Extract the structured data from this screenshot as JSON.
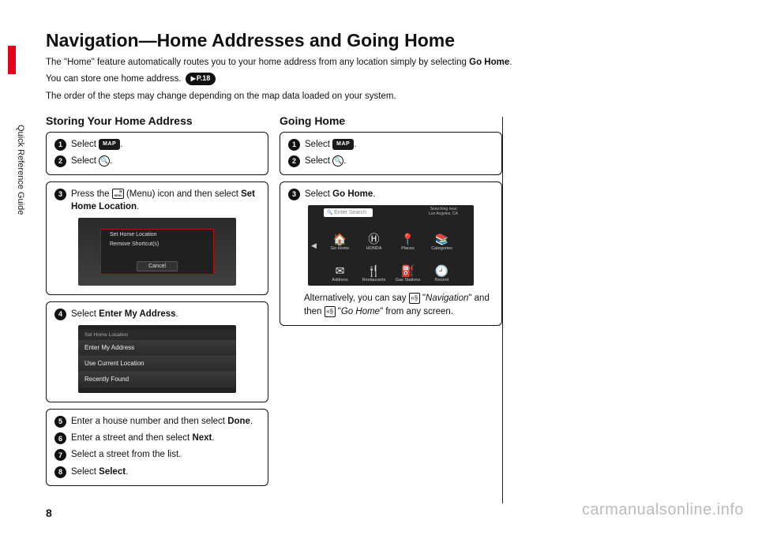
{
  "side_label": "Quick Reference Guide",
  "page_number": "8",
  "watermark": "carmanualsonline.info",
  "title": "Navigation—Home Addresses and Going Home",
  "intro1_pre": "The \"Home\" feature automatically routes you to your home address from any location simply by selecting ",
  "intro1_bold": "Go Home",
  "intro2_pre": "You can store one home address. ",
  "pref": "P.18",
  "intro3": "The order of the steps may change depending on the map data loaded on your system.",
  "colA_title": "Storing Your Home Address",
  "colB_title": "Going Home",
  "step_select": "Select ",
  "map_label": "MAP",
  "q_glyph": "🔍",
  "colA": {
    "s3_pre": "Press the ",
    "s3_mid": " (Menu) icon and then select ",
    "s3_bold": "Set Home Location",
    "s4_pre": "Select ",
    "s4_bold": "Enter My Address",
    "s5_pre": "Enter a house number and then select ",
    "s5_bold": "Done",
    "s6_pre": "Enter a street and then select ",
    "s6_bold": "Next",
    "s7": "Select a street from the list.",
    "s8_pre": "Select ",
    "s8_bold": "Select",
    "shot1_top": "Set Home Location",
    "shot1_mid": "Remove Shortcut(s)",
    "shot1_cancel": "Cancel",
    "shot2_hdr": "Set Home Location",
    "shot2_r1": "Enter My Address",
    "shot2_r2": "Use Current Location",
    "shot2_r3": "Recently Found"
  },
  "colB": {
    "s3_pre": "Select ",
    "s3_bold": "Go Home",
    "note_pre": "Alternatively, you can say ",
    "note_nav": "Navigation",
    "note_mid": " and then ",
    "note_go": "Go Home",
    "note_post": " from any screen.",
    "shot3_search": "Enter Search",
    "shot3_near1": "Searching near:",
    "shot3_near2": "Los Angeles, CA",
    "tiles": [
      "Go Home",
      "HONDA",
      "Places",
      "Categories",
      "Address",
      "Restaurants",
      "Gas Stations",
      "Recent"
    ],
    "tile_icons": [
      "🏠",
      "Ⓗ",
      "📍",
      "📚",
      "✉",
      "🍴",
      "⛽",
      "🕘"
    ]
  }
}
